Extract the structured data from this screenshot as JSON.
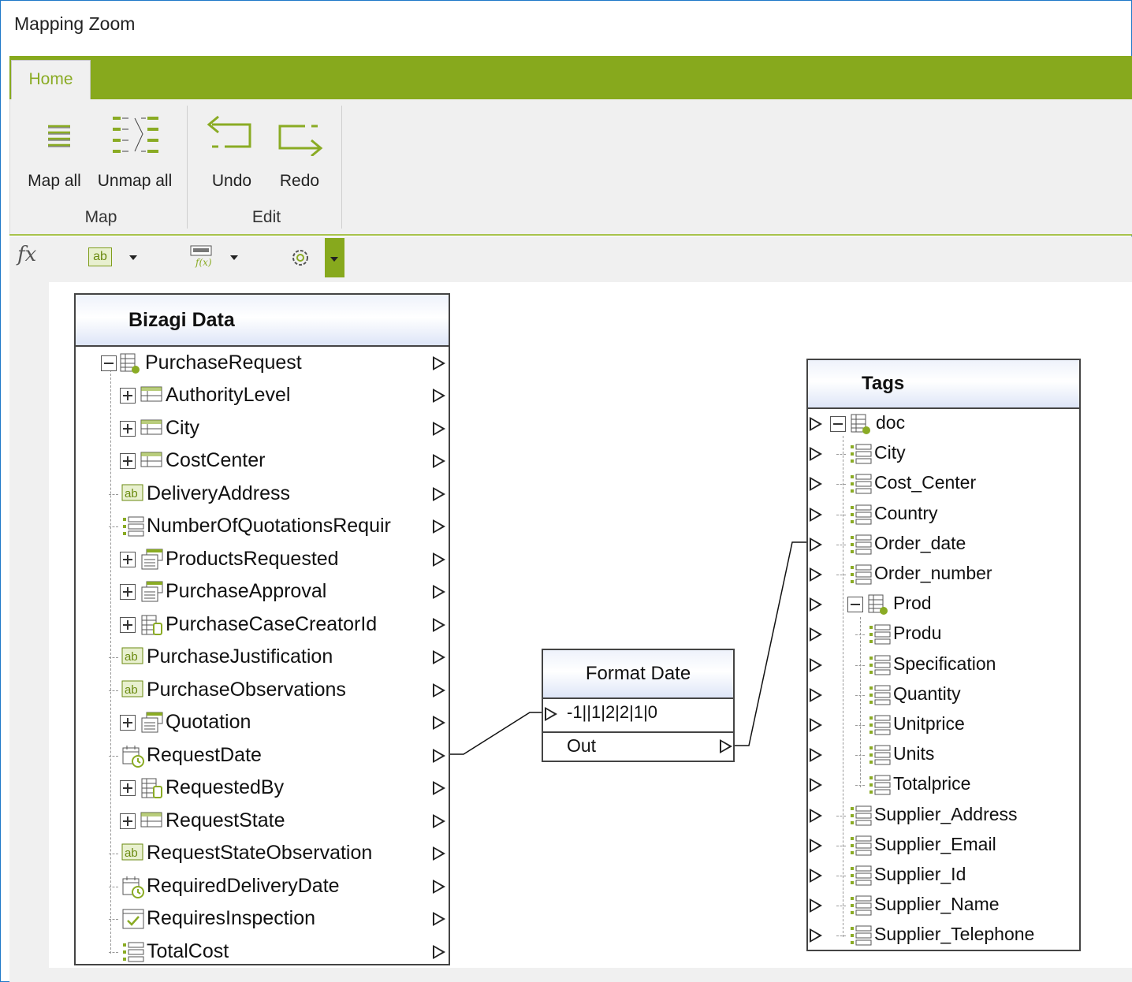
{
  "window": {
    "title": "Mapping Zoom"
  },
  "ribbon": {
    "tabs": [
      {
        "label": "Home",
        "active": true
      }
    ],
    "groups": [
      {
        "label": "Map",
        "buttons": [
          {
            "label": "Map all",
            "icon": "map-all-icon"
          },
          {
            "label": "Unmap all",
            "icon": "unmap-all-icon"
          }
        ]
      },
      {
        "label": "Edit",
        "buttons": [
          {
            "label": "Undo",
            "icon": "undo-icon"
          },
          {
            "label": "Redo",
            "icon": "redo-icon"
          }
        ]
      }
    ]
  },
  "toolbar": {
    "items": [
      {
        "icon": "function-icon",
        "text": "fx"
      },
      {
        "icon": "text-ab-icon",
        "text": "ab",
        "dropdown": true
      },
      {
        "icon": "xslt-function-icon",
        "dropdown": true
      },
      {
        "icon": "gear-icon",
        "dropdown": true
      }
    ]
  },
  "source": {
    "title": "Bizagi Data",
    "items": [
      {
        "label": "PurchaseRequest",
        "icon": "entity-icon",
        "expander": "minus",
        "level": 0
      },
      {
        "label": "AuthorityLevel",
        "icon": "table-icon",
        "expander": "plus",
        "level": 1
      },
      {
        "label": "City",
        "icon": "table-icon",
        "expander": "plus",
        "level": 1
      },
      {
        "label": "CostCenter",
        "icon": "table-icon",
        "expander": "plus",
        "level": 1
      },
      {
        "label": "DeliveryAddress",
        "icon": "text-ab-icon",
        "level": 1
      },
      {
        "label": "NumberOfQuotationsRequir",
        "icon": "list-icon",
        "level": 1
      },
      {
        "label": "ProductsRequested",
        "icon": "collection-icon",
        "expander": "plus",
        "level": 1
      },
      {
        "label": "PurchaseApproval",
        "icon": "collection-icon",
        "expander": "plus",
        "level": 1
      },
      {
        "label": "PurchaseCaseCreatorId",
        "icon": "user-entity-icon",
        "expander": "plus",
        "level": 1
      },
      {
        "label": "PurchaseJustification",
        "icon": "text-ab-icon",
        "level": 1
      },
      {
        "label": "PurchaseObservations",
        "icon": "text-ab-icon",
        "level": 1
      },
      {
        "label": "Quotation",
        "icon": "collection-icon",
        "expander": "plus",
        "level": 1
      },
      {
        "label": "RequestDate",
        "icon": "calendar-icon",
        "level": 1
      },
      {
        "label": "RequestedBy",
        "icon": "user-entity-icon",
        "expander": "plus",
        "level": 1
      },
      {
        "label": "RequestState",
        "icon": "table-icon",
        "expander": "plus",
        "level": 1
      },
      {
        "label": "RequestStateObservation",
        "icon": "text-ab-icon",
        "level": 1
      },
      {
        "label": "RequiredDeliveryDate",
        "icon": "calendar-icon",
        "level": 1
      },
      {
        "label": "RequiresInspection",
        "icon": "checkbox-icon",
        "level": 1
      },
      {
        "label": "TotalCost",
        "icon": "list-icon",
        "level": 1
      }
    ]
  },
  "function_box": {
    "title": "Format Date",
    "input": "-1||1|2|2|1|0",
    "output": "Out"
  },
  "target": {
    "title": "Tags",
    "items": [
      {
        "label": "doc",
        "icon": "doc-entity-icon",
        "expander": "minus",
        "level": 0
      },
      {
        "label": "City",
        "icon": "list-icon",
        "level": 1
      },
      {
        "label": "Cost_Center",
        "icon": "list-icon",
        "level": 1
      },
      {
        "label": "Country",
        "icon": "list-icon",
        "level": 1
      },
      {
        "label": "Order_date",
        "icon": "list-icon",
        "level": 1
      },
      {
        "label": "Order_number",
        "icon": "list-icon",
        "level": 1
      },
      {
        "label": "Prod",
        "icon": "doc-entity-icon",
        "expander": "minus",
        "level": 1
      },
      {
        "label": "Produ",
        "icon": "list-icon",
        "level": 2
      },
      {
        "label": "Specification",
        "icon": "list-icon",
        "level": 2
      },
      {
        "label": "Quantity",
        "icon": "list-icon",
        "level": 2
      },
      {
        "label": "Unitprice",
        "icon": "list-icon",
        "level": 2
      },
      {
        "label": "Units",
        "icon": "list-icon",
        "level": 2
      },
      {
        "label": "Totalprice",
        "icon": "list-icon",
        "level": 2
      },
      {
        "label": "Supplier_Address",
        "icon": "list-icon",
        "level": 1
      },
      {
        "label": "Supplier_Email",
        "icon": "list-icon",
        "level": 1
      },
      {
        "label": "Supplier_Id",
        "icon": "list-icon",
        "level": 1
      },
      {
        "label": "Supplier_Name",
        "icon": "list-icon",
        "level": 1
      },
      {
        "label": "Supplier_Telephone",
        "icon": "list-icon",
        "level": 1
      }
    ]
  },
  "colors": {
    "accent": "#87a91d",
    "icon_green": "#8aab24",
    "header_blue": "#dde5f7"
  }
}
